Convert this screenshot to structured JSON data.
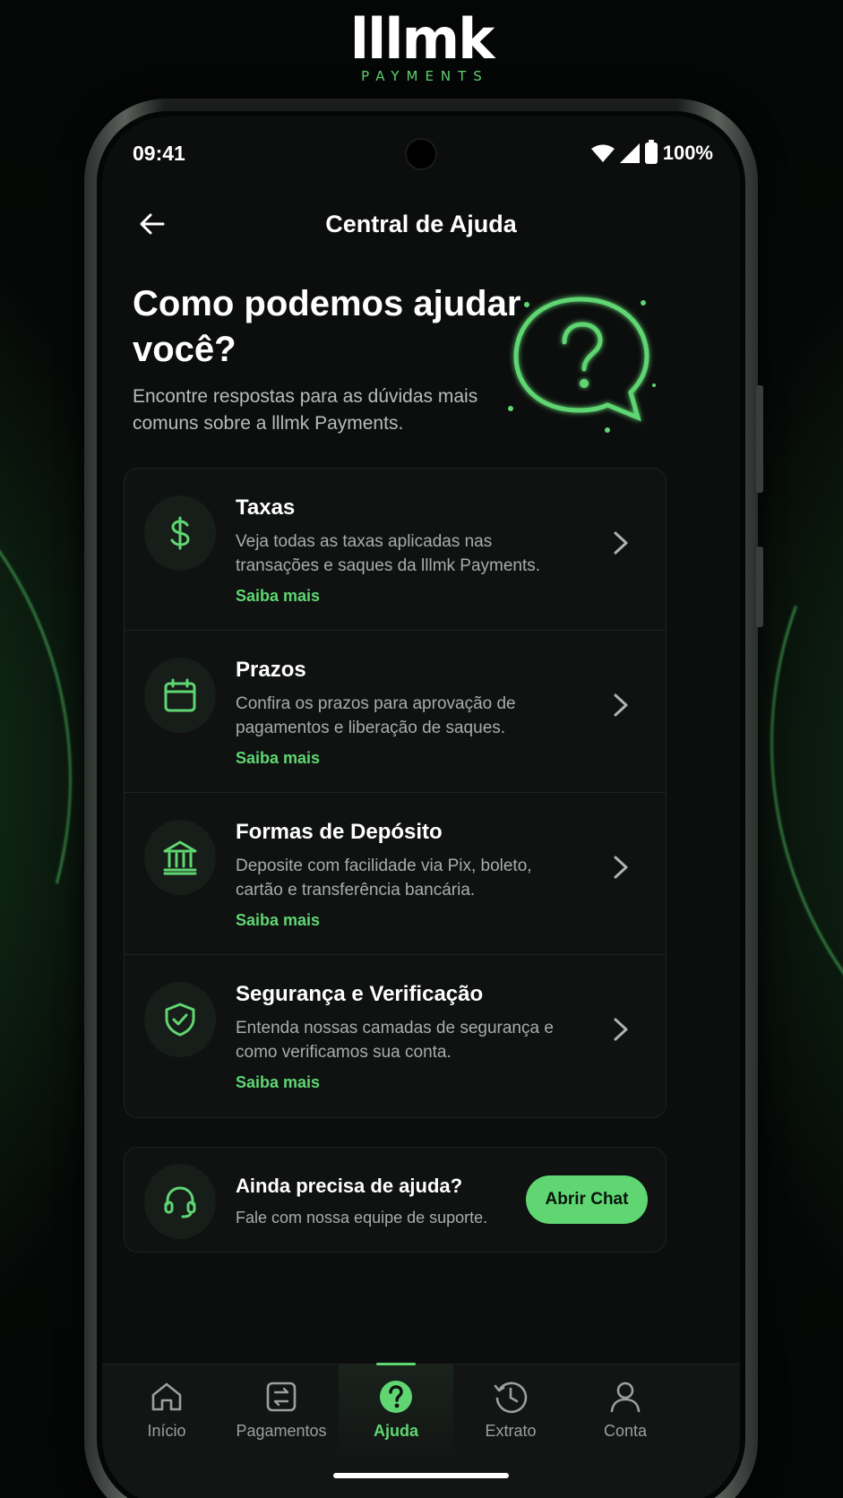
{
  "brand": {
    "wordmark": "lllmk",
    "tagline": "PAYMENTS",
    "accent": "#5fd672"
  },
  "status_bar": {
    "time": "09:41",
    "battery": "100%",
    "icons": [
      "wifi-icon",
      "signal-icon",
      "battery-icon"
    ]
  },
  "header": {
    "title": "Central de Ajuda",
    "back_icon": "arrow-left-icon"
  },
  "hero": {
    "title": "Como podemos ajudar você?",
    "subtitle": "Encontre respostas para as dúvidas mais comuns sobre a lllmk Payments.",
    "illustration": "question-bubble-icon"
  },
  "help_items": [
    {
      "icon": "dollar-icon",
      "title": "Taxas",
      "description": "Veja todas as taxas aplicadas nas transações e saques da lllmk Payments.",
      "link": "Saiba mais"
    },
    {
      "icon": "calendar-icon",
      "title": "Prazos",
      "description": "Confira os prazos para aprovação de pagamentos e liberação de saques.",
      "link": "Saiba mais"
    },
    {
      "icon": "bank-icon",
      "title": "Formas de Depósito",
      "description": "Deposite com facilidade via Pix, boleto, cartão e transferência bancária.",
      "link": "Saiba mais"
    },
    {
      "icon": "shield-check-icon",
      "title": "Segurança e Verificação",
      "description": "Entenda nossas camadas de segurança e como verificamos sua conta.",
      "link": "Saiba mais"
    }
  ],
  "support": {
    "icon": "headset-icon",
    "title": "Ainda precisa de ajuda?",
    "subtitle": "Fale com nossa equipe de suporte.",
    "button": "Abrir Chat"
  },
  "bottom_nav": [
    {
      "icon": "home-icon",
      "label": "Início",
      "active": false
    },
    {
      "icon": "payments-icon",
      "label": "Pagamentos",
      "active": false
    },
    {
      "icon": "help-icon",
      "label": "Ajuda",
      "active": true
    },
    {
      "icon": "history-icon",
      "label": "Extrato",
      "active": false
    },
    {
      "icon": "user-icon",
      "label": "Conta",
      "active": false
    }
  ]
}
